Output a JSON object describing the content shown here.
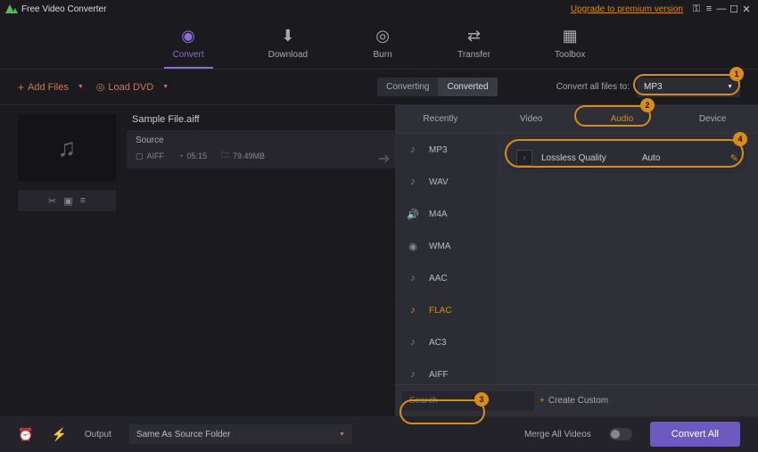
{
  "app": {
    "title": "Free Video Converter",
    "upgrade": "Upgrade to premium version"
  },
  "nav": {
    "items": [
      {
        "label": "Convert"
      },
      {
        "label": "Download"
      },
      {
        "label": "Burn"
      },
      {
        "label": "Transfer"
      },
      {
        "label": "Toolbox"
      }
    ]
  },
  "toolbar": {
    "add_files": "Add Files",
    "load_dvd": "Load DVD",
    "tabs": {
      "converting": "Converting",
      "converted": "Converted"
    },
    "convert_all_label": "Convert all files to:",
    "target_format": "MP3"
  },
  "file": {
    "name": "Sample File.aiff",
    "source_label": "Source",
    "codec": "AIFF",
    "duration": "05:15",
    "size": "79.49MB"
  },
  "panel": {
    "tabs": {
      "recently": "Recently",
      "video": "Video",
      "audio": "Audio",
      "device": "Device"
    },
    "formats": [
      "MP3",
      "WAV",
      "M4A",
      "WMA",
      "AAC",
      "FLAC",
      "AC3",
      "AIFF"
    ],
    "quality": {
      "name": "Lossless Quality",
      "value": "Auto"
    },
    "search_placeholder": "Search",
    "create_custom": "Create Custom"
  },
  "footer": {
    "output_label": "Output",
    "output_path": "Same As Source Folder",
    "merge_label": "Merge All Videos",
    "convert_all": "Convert All"
  },
  "annot": {
    "n1": "1",
    "n2": "2",
    "n3": "3",
    "n4": "4"
  }
}
